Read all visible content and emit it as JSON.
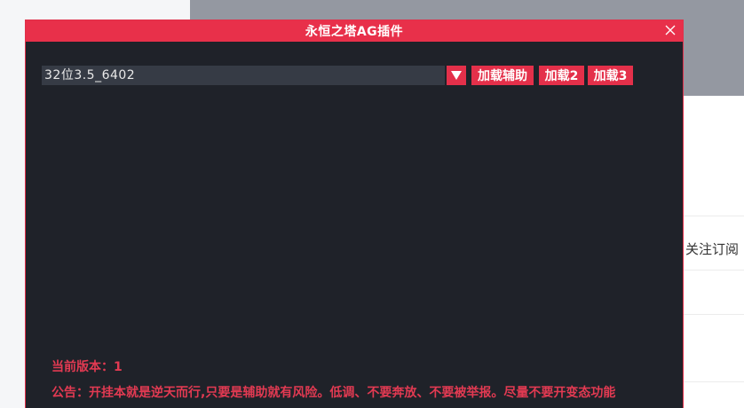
{
  "background_page": {
    "follow_label": "关注订阅"
  },
  "window": {
    "title": "永恒之塔AG插件",
    "close_icon": "close-icon",
    "version_select": {
      "value": "32位3.5_6402"
    },
    "dropdown_icon": "triangle-down-icon",
    "buttons": {
      "load_assist": "加载辅助",
      "load_2": "加载2",
      "load_3": "加载3"
    },
    "current_version_label": "当前版本：",
    "current_version_value": "1",
    "notice_label": "公告：",
    "notice_text": "开挂本就是逆天而行,只要是辅助就有风险。低调、不要奔放、不要被举报。尽量不要开变态功能"
  },
  "colors": {
    "accent": "#e8304a",
    "window_bg": "#1f2229",
    "select_bg": "#363b45",
    "notice_text": "#e23a52"
  }
}
